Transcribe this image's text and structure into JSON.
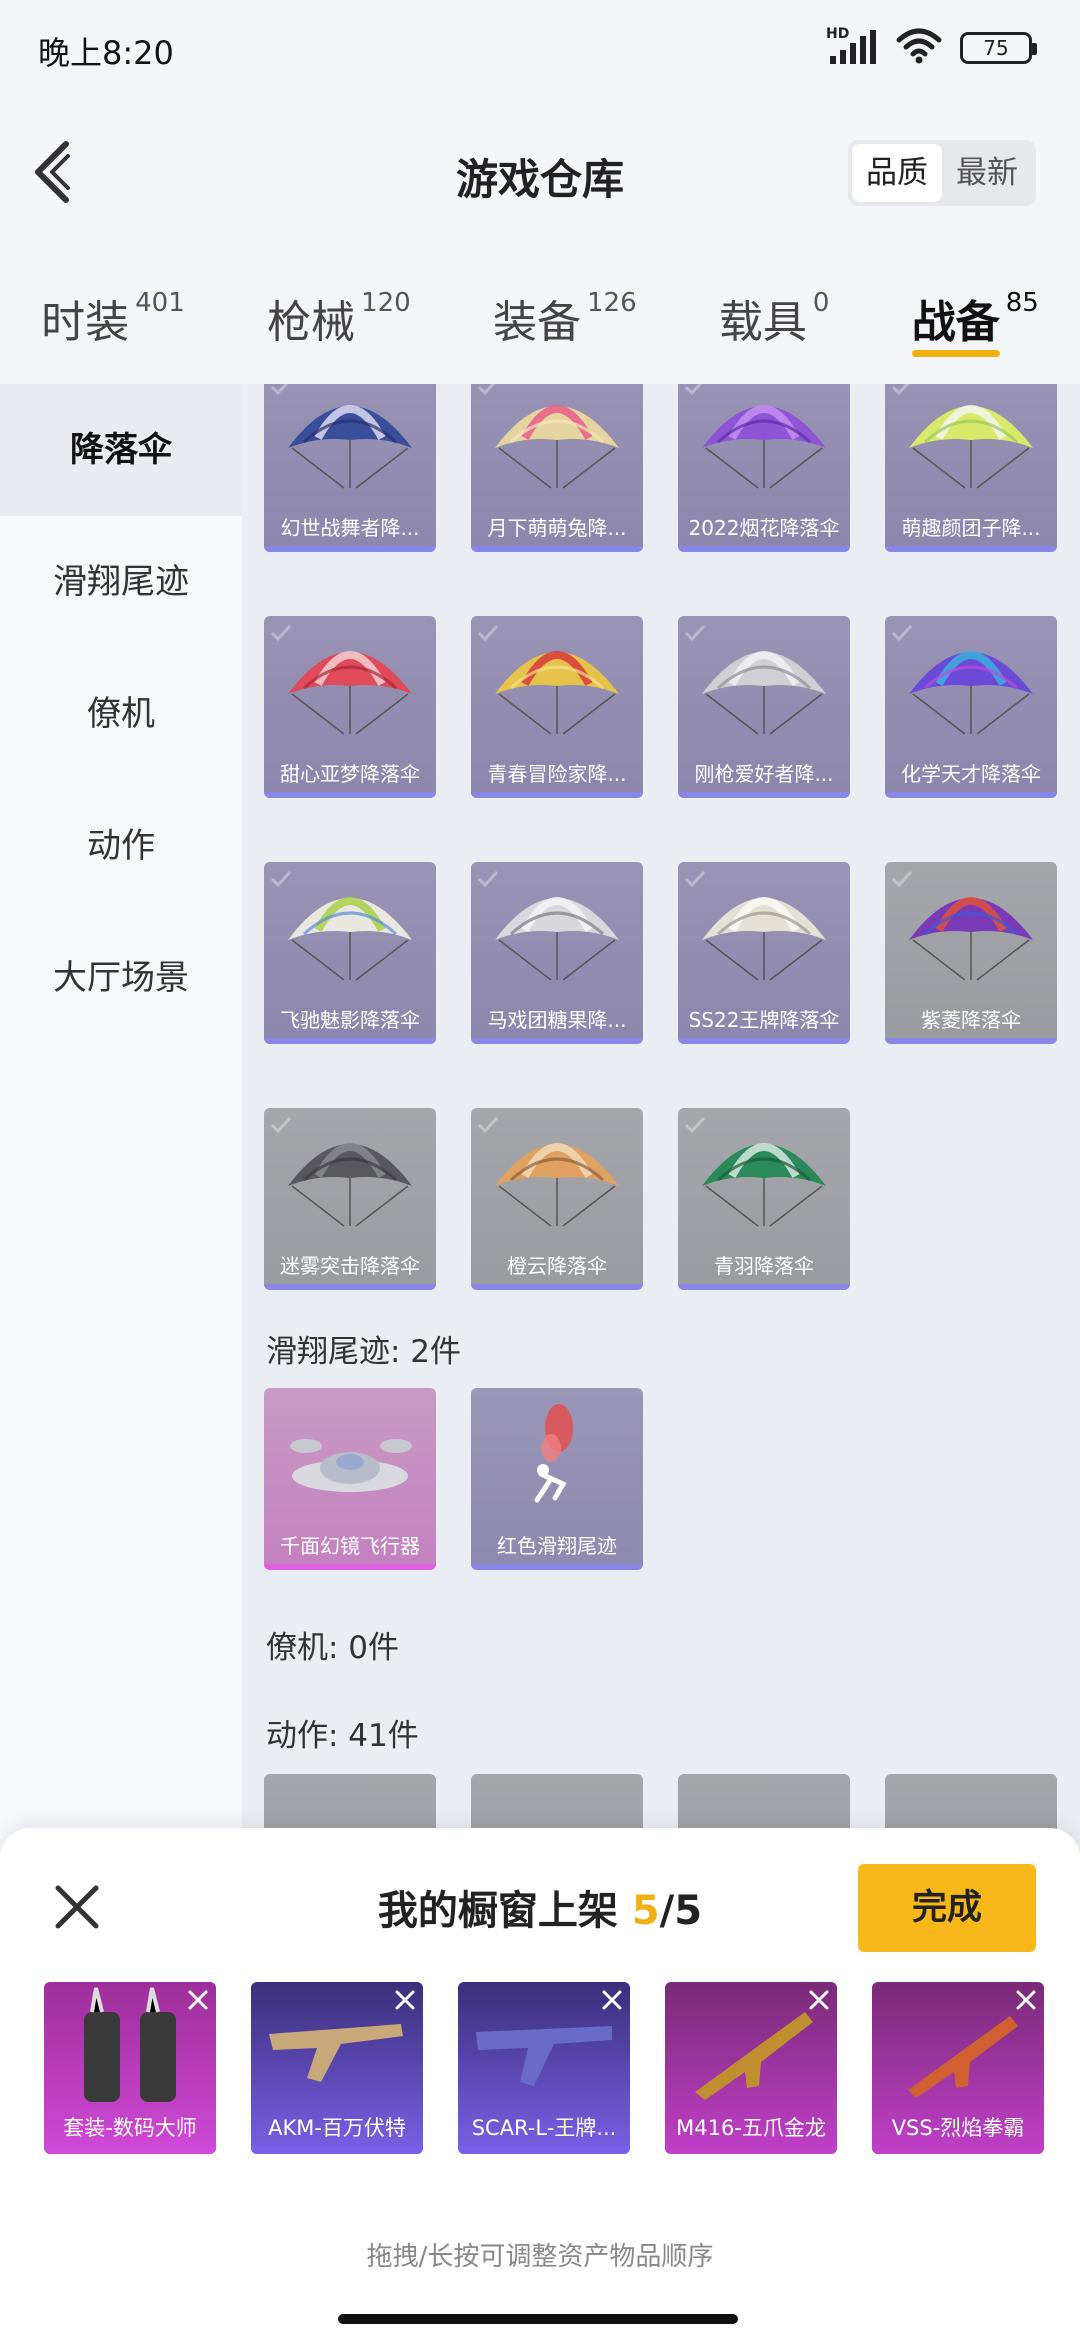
{
  "status_bar": {
    "time": "晚上8:20",
    "network": "HD",
    "battery": "75"
  },
  "header": {
    "title": "游戏仓库",
    "sort_options": [
      "品质",
      "最新"
    ],
    "active_sort": "品质"
  },
  "tabs": [
    {
      "label": "时装",
      "count": "401"
    },
    {
      "label": "枪械",
      "count": "120"
    },
    {
      "label": "装备",
      "count": "126"
    },
    {
      "label": "载具",
      "count": "0"
    },
    {
      "label": "战备",
      "count": "85"
    }
  ],
  "sidenav": [
    "降落伞",
    "滑翔尾迹",
    "僚机",
    "动作",
    "大厅场景"
  ],
  "parachutes": [
    {
      "name": "幻世战舞者降...",
      "colors": [
        "#3a4f9c",
        "#d9d9f0",
        "#2a2e6a"
      ]
    },
    {
      "name": "月下萌萌兔降...",
      "colors": [
        "#e5d4a0",
        "#e85c8a",
        "#f7e7b8"
      ]
    },
    {
      "name": "2022烟花降落伞",
      "colors": [
        "#8b55d6",
        "#c78ff0",
        "#5a2fa8"
      ]
    },
    {
      "name": "萌趣颜团子降...",
      "colors": [
        "#d8e86a",
        "#f4f4f0",
        "#9bc85a"
      ]
    },
    {
      "name": "甜心亚梦降落伞",
      "colors": [
        "#e04a5a",
        "#f2d0d0",
        "#a82838"
      ]
    },
    {
      "name": "青春冒险家降...",
      "colors": [
        "#e7c24a",
        "#d63a3a",
        "#f5e08a"
      ]
    },
    {
      "name": "刚枪爱好者降...",
      "colors": [
        "#cfcfd4",
        "#f1f1f3",
        "#8d8d96"
      ]
    },
    {
      "name": "化学天才降落伞",
      "colors": [
        "#6a4bd8",
        "#3ab0e0",
        "#c04ad8"
      ]
    },
    {
      "name": "飞驰魅影降落伞",
      "colors": [
        "#e8e8e0",
        "#a8d048",
        "#5a8ad8"
      ]
    },
    {
      "name": "马戏团糖果降...",
      "colors": [
        "#d8d8dc",
        "#f4f4f6",
        "#7a7a82"
      ]
    },
    {
      "name": "SS22王牌降落伞",
      "colors": [
        "#e4e0d6",
        "#fafaf6",
        "#9a968c"
      ]
    },
    {
      "name": "紫菱降落伞",
      "colors": [
        "#7a3ab8",
        "#e0503a",
        "#3a5ad8"
      ]
    },
    {
      "name": "迷雾突击降落伞",
      "colors": [
        "#58585e",
        "#8a8a90",
        "#3a3a40"
      ]
    },
    {
      "name": "橙云降落伞",
      "colors": [
        "#e0a060",
        "#f0d8b8",
        "#8a6040"
      ]
    },
    {
      "name": "青羽降落伞",
      "colors": [
        "#2a8a5a",
        "#d8e8e0",
        "#1a5a3a"
      ]
    }
  ],
  "glide_trail_section": "滑翔尾迹: 2件",
  "glide_trails": [
    {
      "name": "千面幻镜飞行器"
    },
    {
      "name": "红色滑翔尾迹"
    }
  ],
  "wingman_section": "僚机: 0件",
  "emote_section": "动作: 41件",
  "showcase": {
    "title": "我的橱窗上架",
    "current": "5",
    "total": "/5",
    "done_label": "完成",
    "items": [
      {
        "name": "套装-数码大师",
        "bg": "#9d2f9a",
        "bar": "#d04ad8"
      },
      {
        "name": "AKM-百万伏特",
        "bg": "#3a2f7a",
        "bar": "#7a60e6"
      },
      {
        "name": "SCAR-L-王牌...",
        "bg": "#3a2f7a",
        "bar": "#7a60e6"
      },
      {
        "name": "M416-五爪金龙",
        "bg": "#7a2a78",
        "bar": "#c040c8"
      },
      {
        "name": "VSS-烈焰拳霸",
        "bg": "#7a2a78",
        "bar": "#c040c8"
      }
    ],
    "hint": "拖拽/长按可调整资产物品顺序"
  }
}
